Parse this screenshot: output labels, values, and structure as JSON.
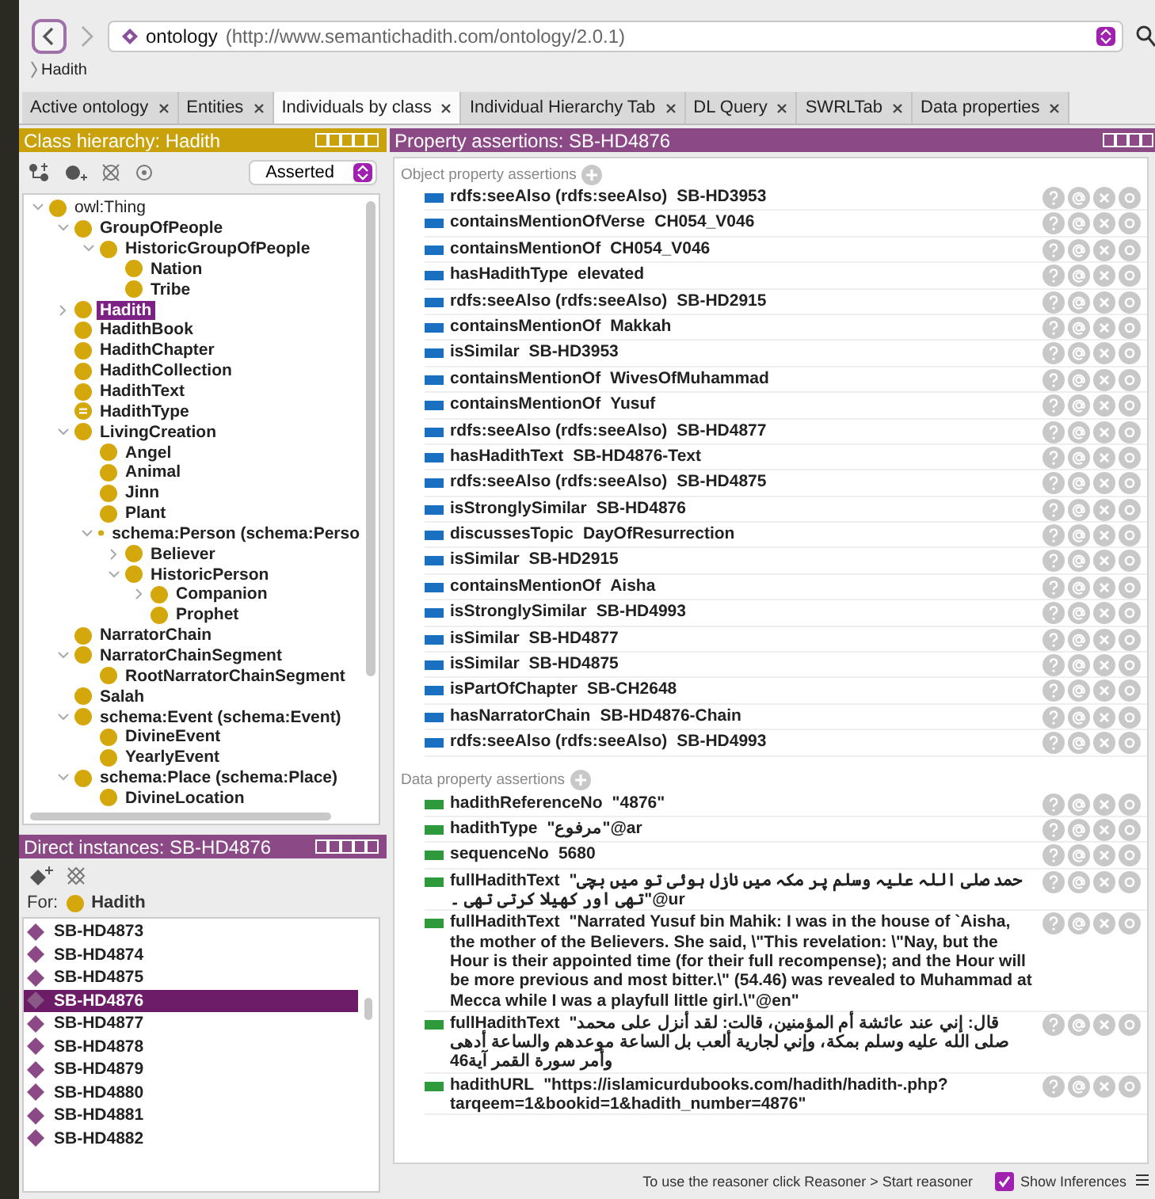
{
  "navigation": {
    "address_name": "ontology",
    "address_url": "(http://www.semantichadith.com/ontology/2.0.1)",
    "breadcrumb": "Hadith"
  },
  "tabs": [
    {
      "label": "Active ontology",
      "selected": false
    },
    {
      "label": "Entities",
      "selected": false
    },
    {
      "label": "Individuals by class",
      "selected": true
    },
    {
      "label": "Individual Hierarchy Tab",
      "selected": false
    },
    {
      "label": "DL Query",
      "selected": false
    },
    {
      "label": "SWRLTab",
      "selected": false
    },
    {
      "label": "Data properties",
      "selected": false
    }
  ],
  "class_hierarchy": {
    "title": "Class hierarchy: Hadith",
    "mode": "Asserted",
    "tree": [
      {
        "label": "owl:Thing",
        "kind": "class",
        "selected": false,
        "expanded": true,
        "children": [
          {
            "label": "GroupOfPeople",
            "kind": "class",
            "selected": false,
            "expanded": true,
            "children": [
              {
                "label": "HistoricGroupOfPeople",
                "kind": "class",
                "selected": false,
                "expanded": true,
                "children": [
                  {
                    "label": "Nation",
                    "kind": "class",
                    "selected": false
                  },
                  {
                    "label": "Tribe",
                    "kind": "class",
                    "selected": false
                  }
                ]
              }
            ]
          },
          {
            "label": "Hadith",
            "kind": "class",
            "selected": true,
            "expanded": false
          },
          {
            "label": "HadithBook",
            "kind": "class",
            "selected": false
          },
          {
            "label": "HadithChapter",
            "kind": "class",
            "selected": false
          },
          {
            "label": "HadithCollection",
            "kind": "class",
            "selected": false
          },
          {
            "label": "HadithText",
            "kind": "class",
            "selected": false
          },
          {
            "label": "HadithType",
            "kind": "defined",
            "selected": false
          },
          {
            "label": "LivingCreation",
            "kind": "class",
            "selected": false,
            "expanded": true,
            "children": [
              {
                "label": "Angel",
                "kind": "class",
                "selected": false
              },
              {
                "label": "Animal",
                "kind": "class",
                "selected": false
              },
              {
                "label": "Jinn",
                "kind": "class",
                "selected": false
              },
              {
                "label": "Plant",
                "kind": "class",
                "selected": false
              },
              {
                "label": "schema:Person (schema:Perso",
                "kind": "class",
                "selected": false,
                "expanded": true,
                "children": [
                  {
                    "label": "Believer",
                    "kind": "class",
                    "selected": false,
                    "expanded": false
                  },
                  {
                    "label": "HistoricPerson",
                    "kind": "class",
                    "selected": false,
                    "expanded": true,
                    "children": [
                      {
                        "label": "Companion",
                        "kind": "class",
                        "selected": false,
                        "expanded": false
                      },
                      {
                        "label": "Prophet",
                        "kind": "class",
                        "selected": false
                      }
                    ]
                  }
                ]
              }
            ]
          },
          {
            "label": "NarratorChain",
            "kind": "class",
            "selected": false
          },
          {
            "label": "NarratorChainSegment",
            "kind": "class",
            "selected": false,
            "expanded": true,
            "children": [
              {
                "label": "RootNarratorChainSegment",
                "kind": "class",
                "selected": false
              }
            ]
          },
          {
            "label": "Salah",
            "kind": "class",
            "selected": false
          },
          {
            "label": "schema:Event (schema:Event)",
            "kind": "class",
            "selected": false,
            "expanded": true,
            "children": [
              {
                "label": "DivineEvent",
                "kind": "class",
                "selected": false
              },
              {
                "label": "YearlyEvent",
                "kind": "class",
                "selected": false
              }
            ]
          },
          {
            "label": "schema:Place (schema:Place)",
            "kind": "class",
            "selected": false,
            "expanded": true,
            "children": [
              {
                "label": "DivineLocation",
                "kind": "class",
                "selected": false
              }
            ]
          }
        ]
      }
    ]
  },
  "direct_instances": {
    "title": "Direct instances: SB-HD4876",
    "for_label": "For:",
    "for_class": "Hadith",
    "items": [
      {
        "label": "SB-HD4873",
        "selected": false
      },
      {
        "label": "SB-HD4874",
        "selected": false
      },
      {
        "label": "SB-HD4875",
        "selected": false
      },
      {
        "label": "SB-HD4876",
        "selected": true
      },
      {
        "label": "SB-HD4877",
        "selected": false
      },
      {
        "label": "SB-HD4878",
        "selected": false
      },
      {
        "label": "SB-HD4879",
        "selected": false
      },
      {
        "label": "SB-HD4880",
        "selected": false
      },
      {
        "label": "SB-HD4881",
        "selected": false
      },
      {
        "label": "SB-HD4882",
        "selected": false
      }
    ]
  },
  "property_assertions": {
    "title": "Property assertions: SB-HD4876",
    "object_section": {
      "title": "Object property assertions",
      "items": [
        {
          "property": "rdfs:seeAlso (rdfs:seeAlso)",
          "value": "SB-HD3953"
        },
        {
          "property": "containsMentionOfVerse",
          "value": "CH054_V046"
        },
        {
          "property": "containsMentionOf",
          "value": "CH054_V046"
        },
        {
          "property": "hasHadithType",
          "value": "elevated"
        },
        {
          "property": "rdfs:seeAlso (rdfs:seeAlso)",
          "value": "SB-HD2915"
        },
        {
          "property": "containsMentionOf",
          "value": "Makkah"
        },
        {
          "property": "isSimilar",
          "value": "SB-HD3953"
        },
        {
          "property": "containsMentionOf",
          "value": "WivesOfMuhammad"
        },
        {
          "property": "containsMentionOf",
          "value": "Yusuf"
        },
        {
          "property": "rdfs:seeAlso (rdfs:seeAlso)",
          "value": "SB-HD4877"
        },
        {
          "property": "hasHadithText",
          "value": "SB-HD4876-Text"
        },
        {
          "property": "rdfs:seeAlso (rdfs:seeAlso)",
          "value": "SB-HD4875"
        },
        {
          "property": "isStronglySimilar",
          "value": "SB-HD4876"
        },
        {
          "property": "discussesTopic",
          "value": "DayOfResurrection"
        },
        {
          "property": "isSimilar",
          "value": "SB-HD2915"
        },
        {
          "property": "containsMentionOf",
          "value": "Aisha"
        },
        {
          "property": "isStronglySimilar",
          "value": "SB-HD4993"
        },
        {
          "property": "isSimilar",
          "value": "SB-HD4877"
        },
        {
          "property": "isSimilar",
          "value": "SB-HD4875"
        },
        {
          "property": "isPartOfChapter",
          "value": "SB-CH2648"
        },
        {
          "property": "hasNarratorChain",
          "value": "SB-HD4876-Chain"
        },
        {
          "property": "rdfs:seeAlso (rdfs:seeAlso)",
          "value": "SB-HD4993"
        }
      ]
    },
    "data_section": {
      "title": "Data property assertions",
      "items": [
        {
          "property": "hadithReferenceNo",
          "value": "\"4876\""
        },
        {
          "property": "hadithType",
          "value": "\"مرفوع\"@ar"
        },
        {
          "property": "sequenceNo",
          "value": "5680"
        },
        {
          "property": "fullHadithText",
          "value": "\"حمد صلی اللہ علیہ وسلم پر مکہ میں نازل ہوئی تو میں بچی تھی اور کھیلا کرتی تھی ۔\"@ur"
        },
        {
          "property": "fullHadithText",
          "value": "\"Narrated Yusuf bin Mahik: I was in the house of `Aisha, the mother of the Believers. She said, \\\"This revelation: \\\"Nay, but the Hour is their appointed time (for their full recompense); and the Hour will be more previous and most bitter.\\\" (54.46) was revealed to Muhammad at Mecca while I was a playfull little girl.\\\"@en\""
        },
        {
          "property": "fullHadithText",
          "value": "\"قال: إني عند عائشة أم المؤمنين، قالت: لقد أنزل على محمد صلى الله عليه وسلم بمكة، وإني لجارية ألعب بل الساعة موعدهم والساعة أدهى وأمر سورة القمر آية46"
        },
        {
          "property": "hadithURL",
          "value": "\"https://islamicurdubooks.com/hadith/hadith-.php?tarqeem=1&bookid=1&hadith_number=4876\""
        }
      ]
    }
  },
  "status_bar": {
    "message": "To use the reasoner click Reasoner > Start reasoner",
    "show_inferences": {
      "label": "Show Inferences",
      "checked": true
    }
  }
}
